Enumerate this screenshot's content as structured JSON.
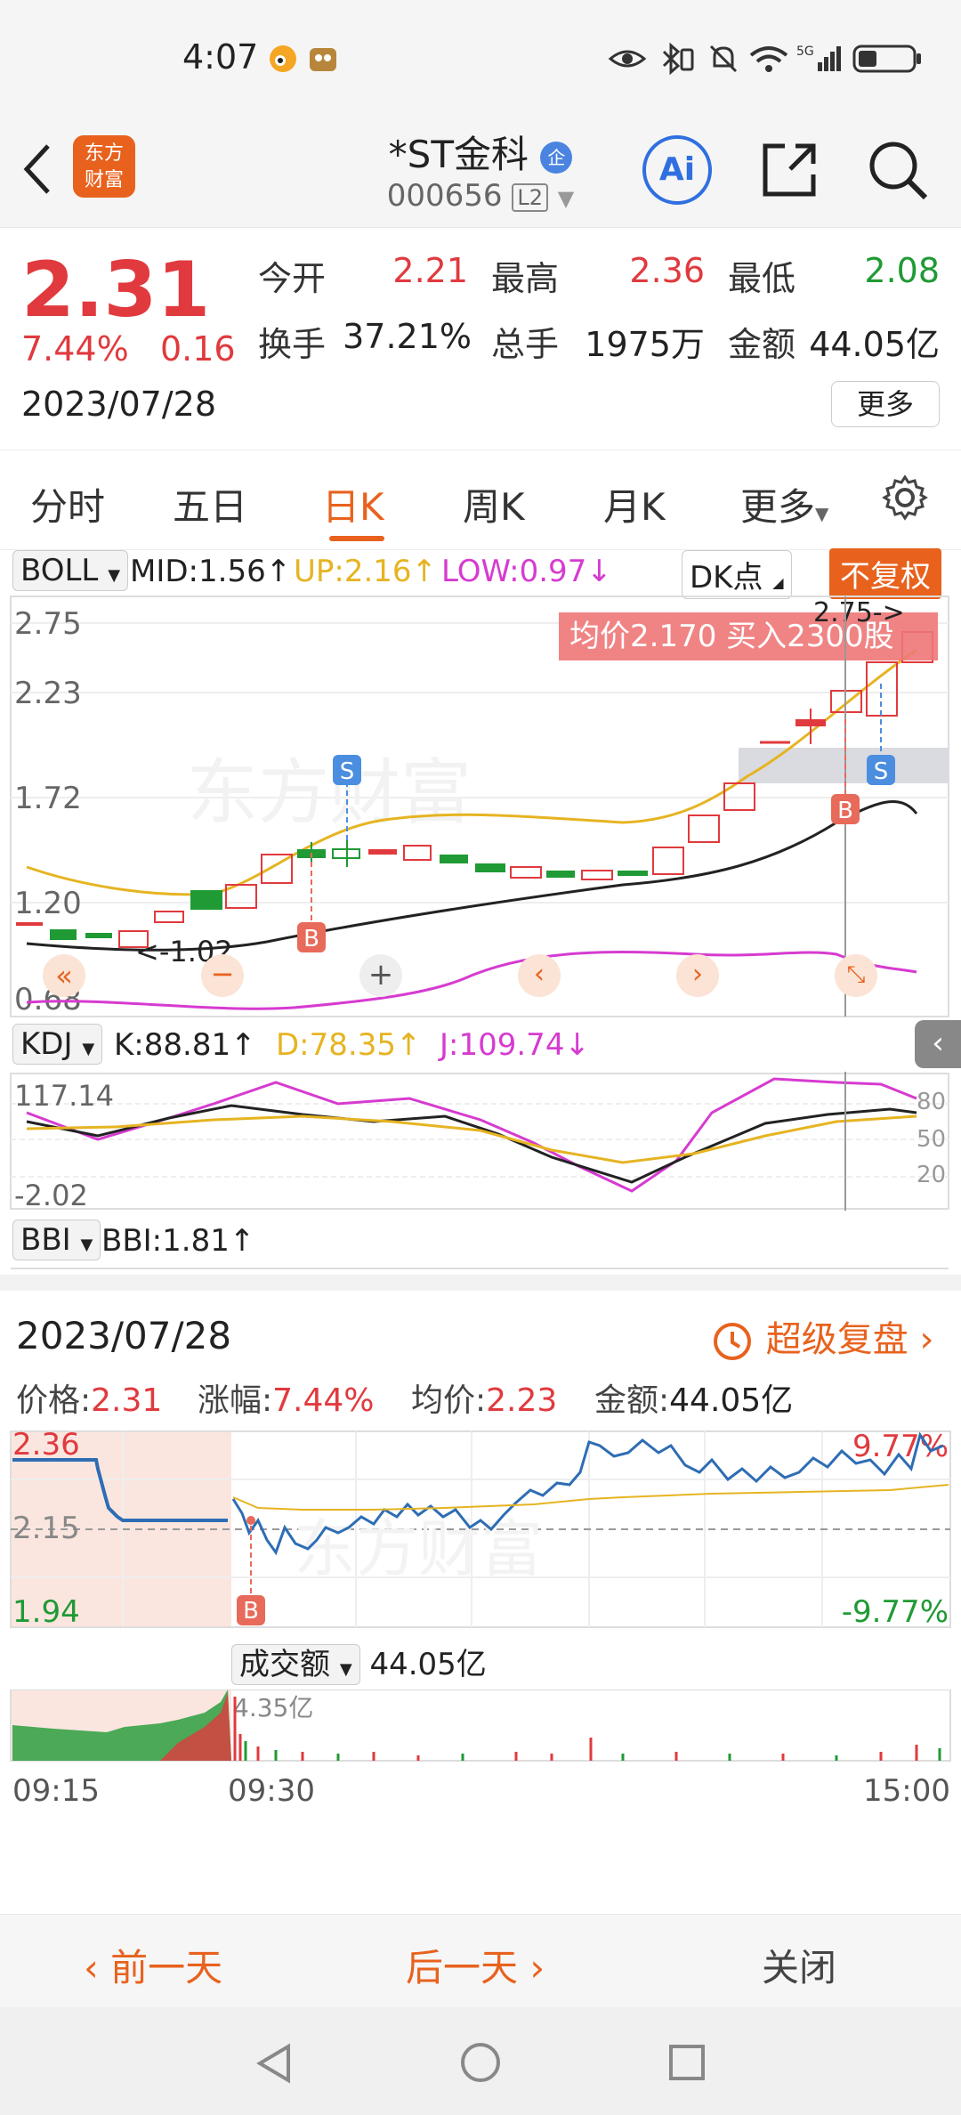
{
  "status_bar": {
    "time": "4:07"
  },
  "header": {
    "title": "*ST金科",
    "title_badge": "企",
    "code": "000656",
    "level_badge": "L2",
    "logo_text_1": "东方",
    "logo_text_2": "财富",
    "ai_label": "Ai"
  },
  "quote": {
    "price": "2.31",
    "change_pct": "7.44%",
    "change": "0.16",
    "date": "2023/07/28",
    "open_label": "今开",
    "open": "2.21",
    "high_label": "最高",
    "high": "2.36",
    "low_label": "最低",
    "low": "2.08",
    "turnover_label": "换手",
    "turnover": "37.21%",
    "volume_label": "总手",
    "volume": "1975万",
    "amount_label": "金额",
    "amount": "44.05亿",
    "more_button": "更多"
  },
  "tabs": [
    "分时",
    "五日",
    "日K",
    "周K",
    "月K",
    "更多"
  ],
  "active_tab": "日K",
  "kline": {
    "boll_select": "BOLL",
    "mid": "MID:1.56↑",
    "up": "UP:2.16↑",
    "low": "LOW:0.97↓",
    "dk_button": "DK点",
    "fq_button": "不复权",
    "y_labels": [
      "2.75",
      "2.23",
      "1.72",
      "1.20",
      "0.68"
    ],
    "trade_banner": "均价2.170  买入2300股",
    "max_marker": "2.75->",
    "min_marker": "<-1.02",
    "buy_marker": "B",
    "sell_marker": "S",
    "watermark": "东方财富"
  },
  "kdj": {
    "select": "KDJ",
    "k": "K:88.81↑",
    "d": "D:78.35↑",
    "j": "J:109.74↓",
    "y_top": "117.14",
    "y_bottom": "-2.02",
    "levels": [
      "80",
      "50",
      "20"
    ]
  },
  "bbi": {
    "select": "BBI",
    "value": "BBI:1.81↑"
  },
  "detail": {
    "date": "2023/07/28",
    "replay_button": "超级复盘",
    "price_label": "价格:",
    "price": "2.31",
    "change_label": "涨幅:",
    "change": "7.44%",
    "avg_label": "均价:",
    "avg": "2.23",
    "amount_label": "金额:",
    "amount": "44.05亿",
    "y_high": "2.36",
    "y_mid": "2.15",
    "y_low": "1.94",
    "pct_high": "9.77%",
    "pct_low": "-9.77%",
    "volume_select": "成交额",
    "volume_total": "44.05亿",
    "volume_max": "4.35亿",
    "times": [
      "09:15",
      "09:30",
      "15:00"
    ]
  },
  "actions": {
    "prev": "前一天",
    "next": "后一天",
    "close": "关闭"
  },
  "colors": {
    "up": "#e03a3e",
    "down": "#1f9a34",
    "accent": "#e8621e",
    "line_blue": "#2e6db4",
    "avg_yellow": "#e6b422",
    "magenta": "#d63bd0"
  }
}
